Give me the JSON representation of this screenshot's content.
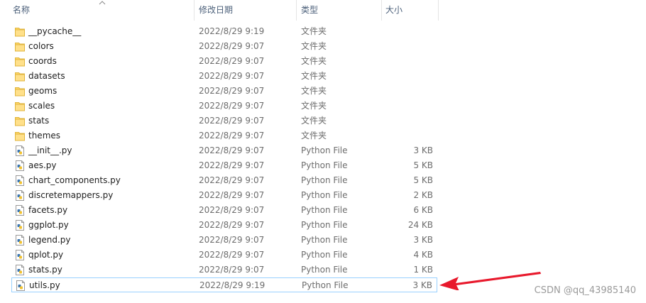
{
  "columns": {
    "name": "名称",
    "date": "修改日期",
    "type": "类型",
    "size": "大小"
  },
  "files": [
    {
      "name": "__pycache__",
      "date": "2022/8/29 9:19",
      "type": "文件夹",
      "size": "",
      "icon": "folder-icon"
    },
    {
      "name": "colors",
      "date": "2022/8/29 9:07",
      "type": "文件夹",
      "size": "",
      "icon": "folder-icon"
    },
    {
      "name": "coords",
      "date": "2022/8/29 9:07",
      "type": "文件夹",
      "size": "",
      "icon": "folder-icon"
    },
    {
      "name": "datasets",
      "date": "2022/8/29 9:07",
      "type": "文件夹",
      "size": "",
      "icon": "folder-icon"
    },
    {
      "name": "geoms",
      "date": "2022/8/29 9:07",
      "type": "文件夹",
      "size": "",
      "icon": "folder-icon"
    },
    {
      "name": "scales",
      "date": "2022/8/29 9:07",
      "type": "文件夹",
      "size": "",
      "icon": "folder-icon"
    },
    {
      "name": "stats",
      "date": "2022/8/29 9:07",
      "type": "文件夹",
      "size": "",
      "icon": "folder-icon"
    },
    {
      "name": "themes",
      "date": "2022/8/29 9:07",
      "type": "文件夹",
      "size": "",
      "icon": "folder-icon"
    },
    {
      "name": "__init__.py",
      "date": "2022/8/29 9:07",
      "type": "Python File",
      "size": "3 KB",
      "icon": "python-file-icon"
    },
    {
      "name": "aes.py",
      "date": "2022/8/29 9:07",
      "type": "Python File",
      "size": "5 KB",
      "icon": "python-file-icon"
    },
    {
      "name": "chart_components.py",
      "date": "2022/8/29 9:07",
      "type": "Python File",
      "size": "5 KB",
      "icon": "python-file-icon"
    },
    {
      "name": "discretemappers.py",
      "date": "2022/8/29 9:07",
      "type": "Python File",
      "size": "2 KB",
      "icon": "python-file-icon"
    },
    {
      "name": "facets.py",
      "date": "2022/8/29 9:07",
      "type": "Python File",
      "size": "6 KB",
      "icon": "python-file-icon"
    },
    {
      "name": "ggplot.py",
      "date": "2022/8/29 9:07",
      "type": "Python File",
      "size": "24 KB",
      "icon": "python-file-icon"
    },
    {
      "name": "legend.py",
      "date": "2022/8/29 9:07",
      "type": "Python File",
      "size": "3 KB",
      "icon": "python-file-icon"
    },
    {
      "name": "qplot.py",
      "date": "2022/8/29 9:07",
      "type": "Python File",
      "size": "4 KB",
      "icon": "python-file-icon"
    },
    {
      "name": "stats.py",
      "date": "2022/8/29 9:07",
      "type": "Python File",
      "size": "1 KB",
      "icon": "python-file-icon"
    },
    {
      "name": "utils.py",
      "date": "2022/8/29 9:19",
      "type": "Python File",
      "size": "3 KB",
      "icon": "python-file-icon",
      "selected": true
    }
  ],
  "watermark": "CSDN @qq_43985140",
  "colors": {
    "folder": "#ffd767",
    "header_text": "#4c607a",
    "selection_border": "#99d1ff",
    "arrow": "#e8192c"
  }
}
